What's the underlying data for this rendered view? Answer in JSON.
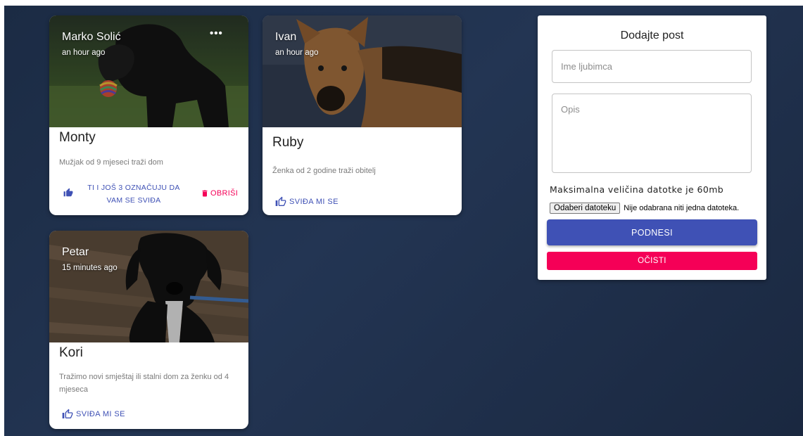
{
  "posts": [
    {
      "owner": "Marko Solić",
      "time": "an hour ago",
      "more_label": "•••",
      "pet_name": "Monty",
      "description": "Mužjak od 9 mjeseci traži dom",
      "liked_text": "TI I JOŠ 3 OZNAČUJU DA VAM SE SVIĐA",
      "delete_label": "OBRIŠI",
      "photo": "dog-black-with-toy"
    },
    {
      "owner": "Ivan",
      "time": "an hour ago",
      "pet_name": "Ruby",
      "description": "Ženka od 2 godine traži obitelj",
      "like_label": "SVIĐA MI SE",
      "photo": "dog-tan-black-snout"
    },
    {
      "owner": "Petar",
      "time": "15 minutes ago",
      "pet_name": "Kori",
      "description": "Tražimo novi smještaj ili stalni dom za ženku od 4 mjeseca",
      "like_label": "SVIĐA MI SE",
      "photo": "puppy-black-with-leash"
    }
  ],
  "form": {
    "title": "Dodajte post",
    "name_placeholder": "Ime ljubimca",
    "name_value": "",
    "desc_placeholder": "Opis",
    "desc_value": "",
    "max_size_text": "Maksimalna veličina datotke je 60mb",
    "file_button": "Odaberi datoteku",
    "file_status": "Nije odabrana niti jedna datoteka.",
    "submit_label": "PODNESI",
    "clear_label": "OČISTI"
  },
  "colors": {
    "background": "#1f2f4a",
    "primary": "#3f51b5",
    "secondary": "#f50057"
  },
  "icons": [
    "more-horiz-icon",
    "thumb-up-filled-icon",
    "thumb-up-outline-icon",
    "delete-icon"
  ]
}
